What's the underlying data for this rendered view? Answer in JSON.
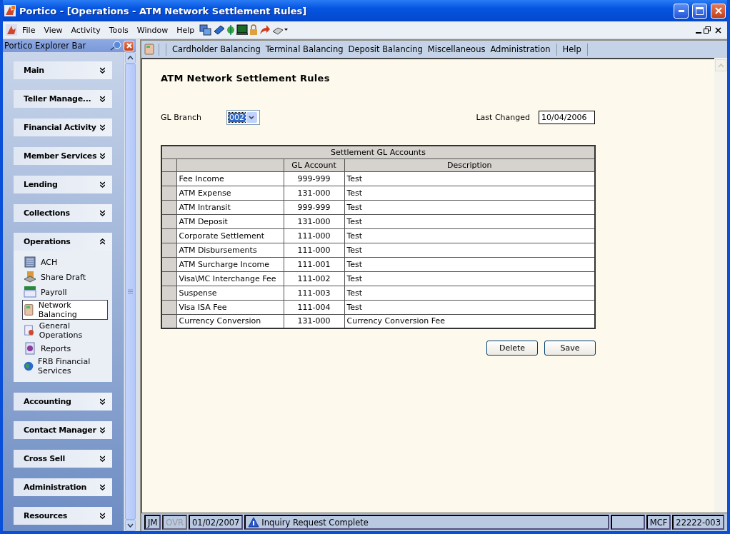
{
  "window": {
    "title": "Portico - [Operations - ATM Network Settlement Rules]"
  },
  "menu": [
    "File",
    "View",
    "Activity",
    "Tools",
    "Window",
    "Help"
  ],
  "explorer": {
    "title": "Portico Explorer Bar",
    "groups": [
      {
        "label": "Main",
        "expanded": false
      },
      {
        "label": "Teller Manage...",
        "expanded": false
      },
      {
        "label": "Financial Activity",
        "expanded": false
      },
      {
        "label": "Member Services",
        "expanded": false
      },
      {
        "label": "Lending",
        "expanded": false
      },
      {
        "label": "Collections",
        "expanded": false
      },
      {
        "label": "Operations",
        "expanded": true,
        "items": [
          {
            "label": "ACH",
            "selected": false
          },
          {
            "label": "Share Draft",
            "selected": false
          },
          {
            "label": "Payroll",
            "selected": false
          },
          {
            "label": "Network Balancing",
            "selected": true
          },
          {
            "label": "General Operations",
            "selected": false
          },
          {
            "label": "Reports",
            "selected": false
          },
          {
            "label": "FRB Financial Services",
            "selected": false
          }
        ]
      },
      {
        "label": "Accounting",
        "expanded": false
      },
      {
        "label": "Contact Manager",
        "expanded": false
      },
      {
        "label": "Cross Sell",
        "expanded": false
      },
      {
        "label": "Administration",
        "expanded": false
      },
      {
        "label": "Resources",
        "expanded": false
      }
    ]
  },
  "module_menu": [
    "Cardholder Balancing",
    "Terminal Balancing",
    "Deposit Balancing",
    "Miscellaneous",
    "Administration",
    "Help"
  ],
  "page_title": "ATM Network Settlement Rules",
  "gl_branch": {
    "label": "GL Branch",
    "value": "002"
  },
  "last_changed": {
    "label": "Last Changed",
    "value": "10/04/2006"
  },
  "table": {
    "title": "Settlement GL Accounts",
    "columns": [
      "GL Account",
      "Description"
    ],
    "rows": [
      {
        "name": "Fee Income",
        "gl_account": "999-999",
        "description": "Test"
      },
      {
        "name": "ATM Expense",
        "gl_account": "131-000",
        "description": "Test"
      },
      {
        "name": "ATM Intransit",
        "gl_account": "999-999",
        "description": "Test"
      },
      {
        "name": "ATM Deposit",
        "gl_account": "131-000",
        "description": "Test"
      },
      {
        "name": "Corporate Settlement",
        "gl_account": "111-000",
        "description": "Test"
      },
      {
        "name": "ATM Disbursements",
        "gl_account": "111-000",
        "description": "Test"
      },
      {
        "name": "ATM Surcharge Income",
        "gl_account": "111-001",
        "description": "Test"
      },
      {
        "name": "Visa\\MC Interchange Fee",
        "gl_account": "111-002",
        "description": "Test"
      },
      {
        "name": "Suspense",
        "gl_account": "111-003",
        "description": "Test"
      },
      {
        "name": "Visa ISA Fee",
        "gl_account": "111-004",
        "description": "Test"
      },
      {
        "name": "Currency Conversion",
        "gl_account": "131-000",
        "description": "Currency Conversion Fee"
      }
    ]
  },
  "buttons": [
    "Delete",
    "Save"
  ],
  "status_bar": [
    {
      "text": "JM",
      "disabled": false
    },
    {
      "text": "OVR",
      "disabled": true
    },
    {
      "text": "01/02/2007",
      "disabled": false
    },
    {
      "text": "Inquiry Request Complete",
      "disabled": false,
      "kind": "message"
    },
    {
      "disabled": false,
      "kind": "blank"
    },
    {
      "text": "MCF",
      "disabled": false
    },
    {
      "text": "22222-003",
      "disabled": false
    }
  ]
}
